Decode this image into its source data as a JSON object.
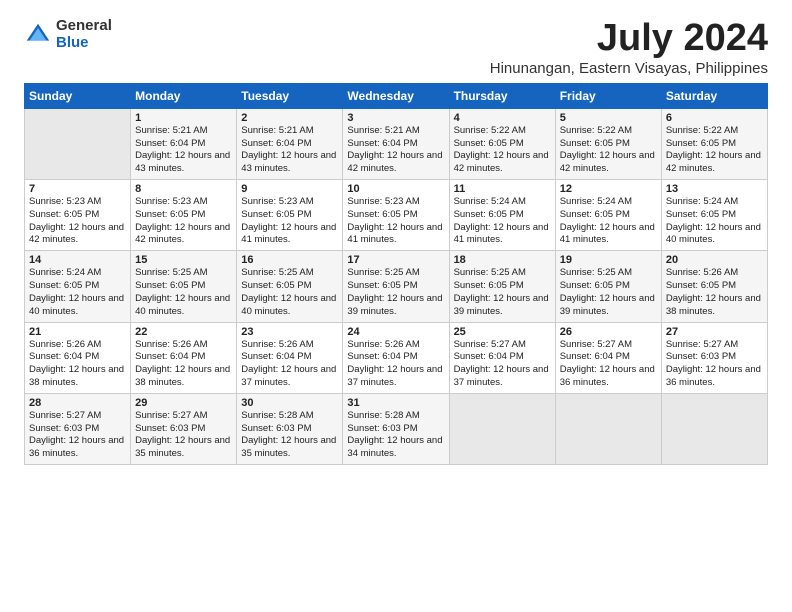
{
  "logo": {
    "general": "General",
    "blue": "Blue"
  },
  "title": "July 2024",
  "subtitle": "Hinunangan, Eastern Visayas, Philippines",
  "days_header": [
    "Sunday",
    "Monday",
    "Tuesday",
    "Wednesday",
    "Thursday",
    "Friday",
    "Saturday"
  ],
  "weeks": [
    [
      {
        "day": "",
        "empty": true
      },
      {
        "day": "1",
        "sunrise": "Sunrise: 5:21 AM",
        "sunset": "Sunset: 6:04 PM",
        "daylight": "Daylight: 12 hours and 43 minutes."
      },
      {
        "day": "2",
        "sunrise": "Sunrise: 5:21 AM",
        "sunset": "Sunset: 6:04 PM",
        "daylight": "Daylight: 12 hours and 43 minutes."
      },
      {
        "day": "3",
        "sunrise": "Sunrise: 5:21 AM",
        "sunset": "Sunset: 6:04 PM",
        "daylight": "Daylight: 12 hours and 42 minutes."
      },
      {
        "day": "4",
        "sunrise": "Sunrise: 5:22 AM",
        "sunset": "Sunset: 6:05 PM",
        "daylight": "Daylight: 12 hours and 42 minutes."
      },
      {
        "day": "5",
        "sunrise": "Sunrise: 5:22 AM",
        "sunset": "Sunset: 6:05 PM",
        "daylight": "Daylight: 12 hours and 42 minutes."
      },
      {
        "day": "6",
        "sunrise": "Sunrise: 5:22 AM",
        "sunset": "Sunset: 6:05 PM",
        "daylight": "Daylight: 12 hours and 42 minutes."
      }
    ],
    [
      {
        "day": "7",
        "sunrise": "Sunrise: 5:23 AM",
        "sunset": "Sunset: 6:05 PM",
        "daylight": "Daylight: 12 hours and 42 minutes."
      },
      {
        "day": "8",
        "sunrise": "Sunrise: 5:23 AM",
        "sunset": "Sunset: 6:05 PM",
        "daylight": "Daylight: 12 hours and 42 minutes."
      },
      {
        "day": "9",
        "sunrise": "Sunrise: 5:23 AM",
        "sunset": "Sunset: 6:05 PM",
        "daylight": "Daylight: 12 hours and 41 minutes."
      },
      {
        "day": "10",
        "sunrise": "Sunrise: 5:23 AM",
        "sunset": "Sunset: 6:05 PM",
        "daylight": "Daylight: 12 hours and 41 minutes."
      },
      {
        "day": "11",
        "sunrise": "Sunrise: 5:24 AM",
        "sunset": "Sunset: 6:05 PM",
        "daylight": "Daylight: 12 hours and 41 minutes."
      },
      {
        "day": "12",
        "sunrise": "Sunrise: 5:24 AM",
        "sunset": "Sunset: 6:05 PM",
        "daylight": "Daylight: 12 hours and 41 minutes."
      },
      {
        "day": "13",
        "sunrise": "Sunrise: 5:24 AM",
        "sunset": "Sunset: 6:05 PM",
        "daylight": "Daylight: 12 hours and 40 minutes."
      }
    ],
    [
      {
        "day": "14",
        "sunrise": "Sunrise: 5:24 AM",
        "sunset": "Sunset: 6:05 PM",
        "daylight": "Daylight: 12 hours and 40 minutes."
      },
      {
        "day": "15",
        "sunrise": "Sunrise: 5:25 AM",
        "sunset": "Sunset: 6:05 PM",
        "daylight": "Daylight: 12 hours and 40 minutes."
      },
      {
        "day": "16",
        "sunrise": "Sunrise: 5:25 AM",
        "sunset": "Sunset: 6:05 PM",
        "daylight": "Daylight: 12 hours and 40 minutes."
      },
      {
        "day": "17",
        "sunrise": "Sunrise: 5:25 AM",
        "sunset": "Sunset: 6:05 PM",
        "daylight": "Daylight: 12 hours and 39 minutes."
      },
      {
        "day": "18",
        "sunrise": "Sunrise: 5:25 AM",
        "sunset": "Sunset: 6:05 PM",
        "daylight": "Daylight: 12 hours and 39 minutes."
      },
      {
        "day": "19",
        "sunrise": "Sunrise: 5:25 AM",
        "sunset": "Sunset: 6:05 PM",
        "daylight": "Daylight: 12 hours and 39 minutes."
      },
      {
        "day": "20",
        "sunrise": "Sunrise: 5:26 AM",
        "sunset": "Sunset: 6:05 PM",
        "daylight": "Daylight: 12 hours and 38 minutes."
      }
    ],
    [
      {
        "day": "21",
        "sunrise": "Sunrise: 5:26 AM",
        "sunset": "Sunset: 6:04 PM",
        "daylight": "Daylight: 12 hours and 38 minutes."
      },
      {
        "day": "22",
        "sunrise": "Sunrise: 5:26 AM",
        "sunset": "Sunset: 6:04 PM",
        "daylight": "Daylight: 12 hours and 38 minutes."
      },
      {
        "day": "23",
        "sunrise": "Sunrise: 5:26 AM",
        "sunset": "Sunset: 6:04 PM",
        "daylight": "Daylight: 12 hours and 37 minutes."
      },
      {
        "day": "24",
        "sunrise": "Sunrise: 5:26 AM",
        "sunset": "Sunset: 6:04 PM",
        "daylight": "Daylight: 12 hours and 37 minutes."
      },
      {
        "day": "25",
        "sunrise": "Sunrise: 5:27 AM",
        "sunset": "Sunset: 6:04 PM",
        "daylight": "Daylight: 12 hours and 37 minutes."
      },
      {
        "day": "26",
        "sunrise": "Sunrise: 5:27 AM",
        "sunset": "Sunset: 6:04 PM",
        "daylight": "Daylight: 12 hours and 36 minutes."
      },
      {
        "day": "27",
        "sunrise": "Sunrise: 5:27 AM",
        "sunset": "Sunset: 6:03 PM",
        "daylight": "Daylight: 12 hours and 36 minutes."
      }
    ],
    [
      {
        "day": "28",
        "sunrise": "Sunrise: 5:27 AM",
        "sunset": "Sunset: 6:03 PM",
        "daylight": "Daylight: 12 hours and 36 minutes."
      },
      {
        "day": "29",
        "sunrise": "Sunrise: 5:27 AM",
        "sunset": "Sunset: 6:03 PM",
        "daylight": "Daylight: 12 hours and 35 minutes."
      },
      {
        "day": "30",
        "sunrise": "Sunrise: 5:28 AM",
        "sunset": "Sunset: 6:03 PM",
        "daylight": "Daylight: 12 hours and 35 minutes."
      },
      {
        "day": "31",
        "sunrise": "Sunrise: 5:28 AM",
        "sunset": "Sunset: 6:03 PM",
        "daylight": "Daylight: 12 hours and 34 minutes."
      },
      {
        "day": "",
        "empty": true
      },
      {
        "day": "",
        "empty": true
      },
      {
        "day": "",
        "empty": true
      }
    ]
  ]
}
